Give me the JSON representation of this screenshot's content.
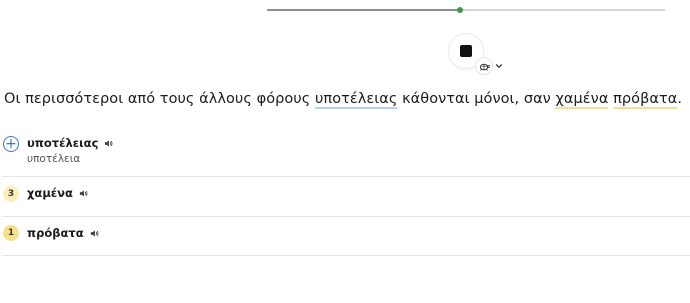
{
  "player": {
    "progress": 0.485,
    "progress_color": "#3c9a4b",
    "stop_icon": "stop-icon",
    "speed_icon": "turtle-icon",
    "speed_dropdown_icon": "chevron-down-icon"
  },
  "sentence": {
    "before": "Οι περισσότεροι από τους άλλους φόρους ",
    "word1": "υποτέλειας",
    "middle": " κάθονται μόνοι, σαν ",
    "word2": "χαμένα",
    "space": " ",
    "word3": "πρόβατα",
    "after": "."
  },
  "words": [
    {
      "badge": "+",
      "word": "υποτέλειας",
      "lemma": "υποτέλεια",
      "badge_color": "#3b78c4"
    },
    {
      "badge": "3",
      "word": "χαμένα",
      "badge_color": "#fbeeb8"
    },
    {
      "badge": "1",
      "word": "πρόβατα",
      "badge_color": "#f7e08a"
    }
  ]
}
